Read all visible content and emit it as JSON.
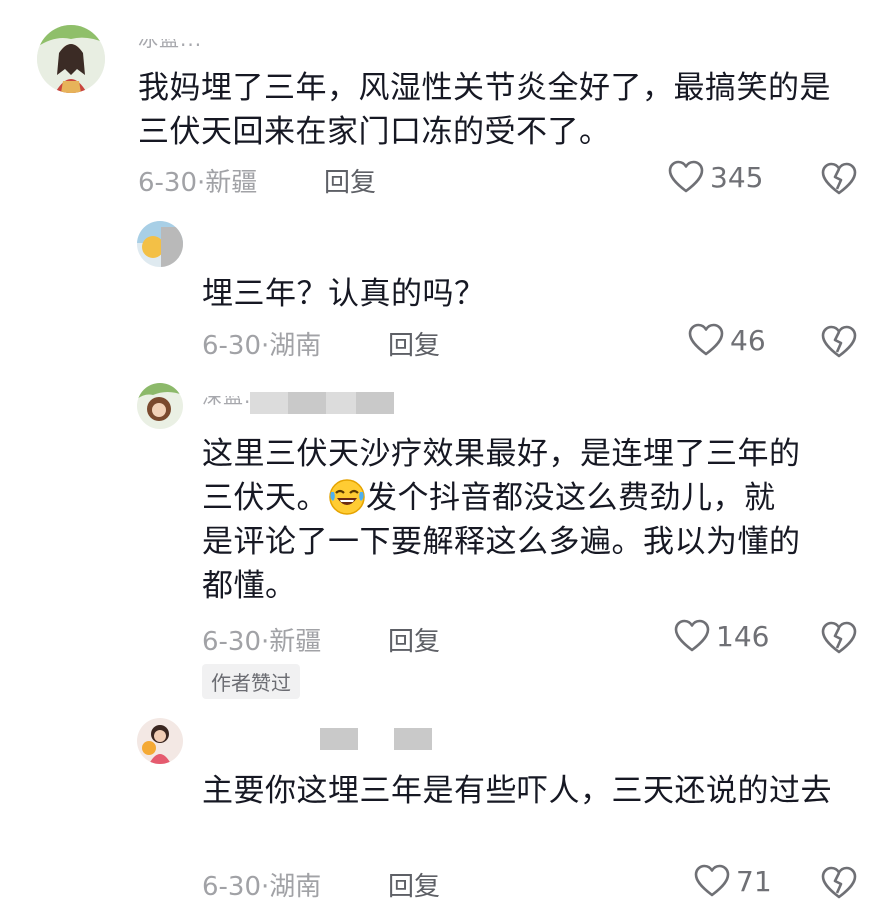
{
  "comments": [
    {
      "username": "冰蓝...",
      "text": "我妈埋了三年，风湿性关节炎全好了，最搞笑的是三伏天回来在家门口冻的受不了。",
      "date": "6-30",
      "location": "新疆",
      "reply_label": "回复",
      "likes": "345"
    },
    {
      "username": "",
      "text": "埋三年？认真的吗？",
      "date": "6-30",
      "location": "湖南",
      "reply_label": "回复",
      "likes": "46"
    },
    {
      "username": "深蓝...",
      "text_line1": "这里三伏天沙疗效果最好，是连埋了三年的",
      "text_line2a": "三伏天。",
      "text_line2b": "发个抖音都没这么费劲儿，就",
      "text_line3": "是评论了一下要解释这么多遍。我以为懂的",
      "text_line4": "都懂。",
      "date": "6-30",
      "location": "新疆",
      "reply_label": "回复",
      "likes": "146",
      "author_badge": "作者赞过"
    },
    {
      "username": "",
      "text": "主要你这埋三年是有些吓人，三天还说的过去",
      "date": "6-30",
      "location": "湖南",
      "reply_label": "回复",
      "likes": "71"
    }
  ],
  "icons": {
    "like": "heart-outline-icon",
    "dislike": "broken-heart-icon",
    "emoji": "laughing-crying-emoji"
  },
  "colors": {
    "text": "#161823",
    "meta": "#a1a2a6",
    "icon": "#6f7075"
  }
}
